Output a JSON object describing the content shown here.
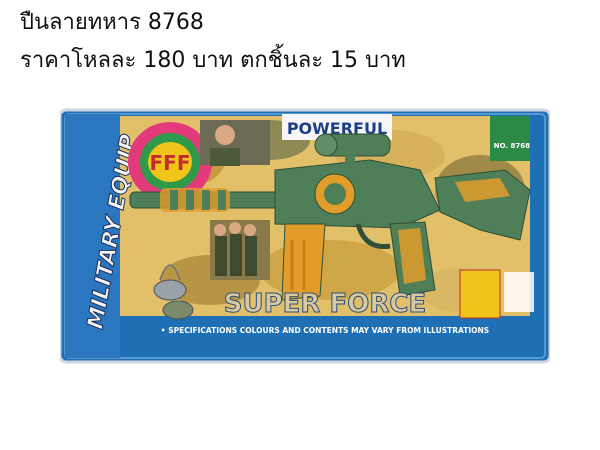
{
  "caption": {
    "line1": "ปืนลายทหาร 8768",
    "line2": "ราคาโหลละ 180 บาท ตกชิ้นละ 15 บาท"
  },
  "package": {
    "header_text": "POWERFUL",
    "logo_text": "FFF",
    "side_text": "MILITARY EQUIP",
    "product_no": "NO. 8768",
    "brand_text": "SUPER FORCE",
    "disclaimer": "• SPECIFICATIONS COLOURS AND CONTENTS MAY VARY FROM ILLUSTRATIONS"
  },
  "colors": {
    "card_blue": "#1f6fb4",
    "camo_tan": "#e2c06a",
    "gun_green": "#4f7f58",
    "gun_orange": "#e29c2a"
  }
}
